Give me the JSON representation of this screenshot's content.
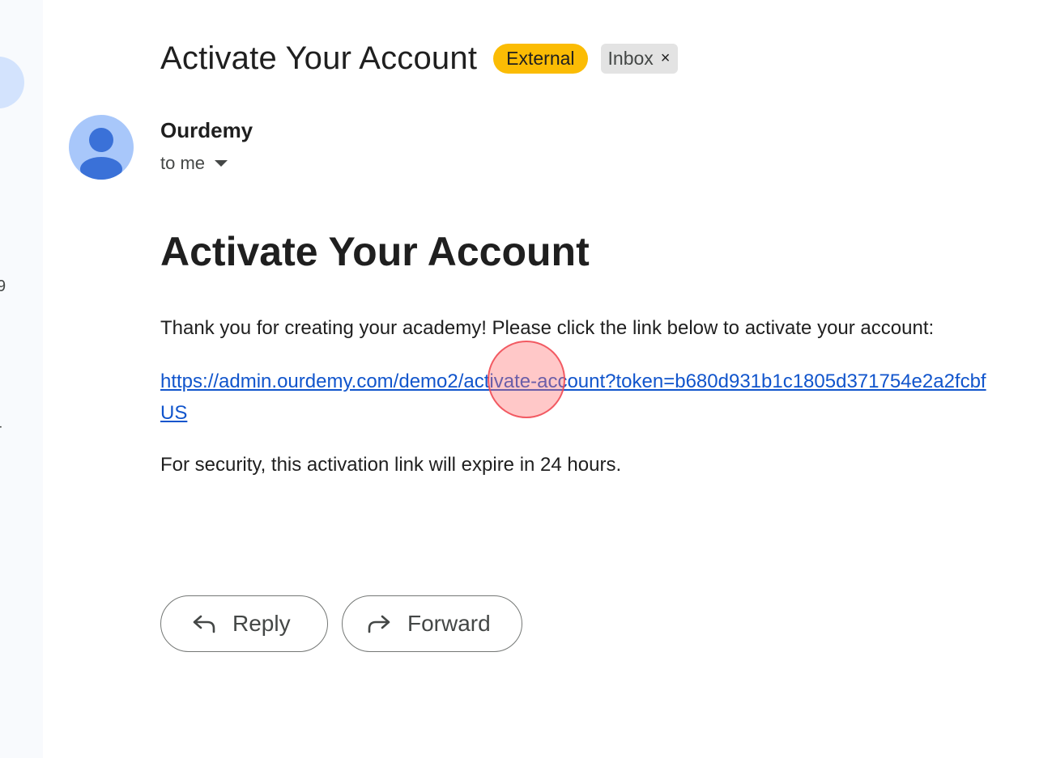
{
  "email": {
    "subject": "Activate Your Account",
    "labels": {
      "external": "External",
      "inbox": "Inbox",
      "inbox_remove": "×"
    },
    "sender": "Ourdemy",
    "recipient": "to me",
    "body": {
      "heading": "Activate Your Account",
      "intro": "Thank you for creating your academy! Please click the link below to activate your account:",
      "activation_link": "https://admin.ourdemy.com/demo2/activate-account?token=b680d931b1c1805d371754e2a2fcbf",
      "activation_link_tail": "US",
      "security_note": "For security, this activation link will expire in 24 hours."
    }
  },
  "actions": {
    "reply_label": "Reply",
    "forward_label": "Forward"
  },
  "sidebar": {
    "fragment_1": "9",
    "fragment_2": "-"
  },
  "colors": {
    "external_badge": "#fbbc04",
    "inbox_badge": "#e3e3e3",
    "link": "#1155cc",
    "avatar_bg": "#a8c7fa",
    "avatar_fg": "#3a71d8",
    "sidebar_bg": "#f8fafd"
  }
}
